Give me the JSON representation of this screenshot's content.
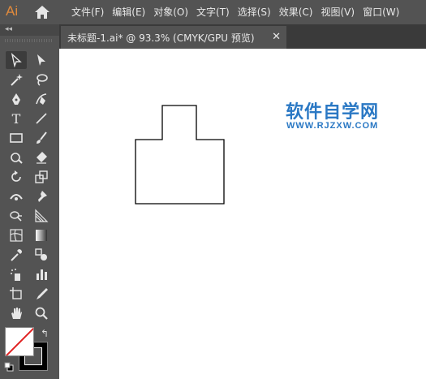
{
  "app": {
    "logo": "Ai"
  },
  "menu": [
    {
      "label": "文件(F)"
    },
    {
      "label": "编辑(E)"
    },
    {
      "label": "对象(O)"
    },
    {
      "label": "文字(T)"
    },
    {
      "label": "选择(S)"
    },
    {
      "label": "效果(C)"
    },
    {
      "label": "视图(V)"
    },
    {
      "label": "窗口(W)"
    }
  ],
  "toolbar": {
    "collapse": "◂◂",
    "tools": [
      "selection-tool",
      "direct-selection-tool",
      "magic-wand-tool",
      "lasso-tool",
      "pen-tool",
      "curvature-tool",
      "type-tool",
      "line-segment-tool",
      "rectangle-tool",
      "paintbrush-tool",
      "shaper-tool",
      "eraser-tool",
      "rotate-tool",
      "scale-tool",
      "width-tool",
      "puppet-warp-tool",
      "shape-builder-tool",
      "perspective-grid-tool",
      "mesh-tool",
      "gradient-tool",
      "eyedropper-tool",
      "blend-tool",
      "symbol-sprayer-tool",
      "column-graph-tool",
      "artboard-tool",
      "slice-tool",
      "hand-tool",
      "zoom-tool"
    ],
    "type_glyph": "T",
    "swap_glyph": "↰"
  },
  "document": {
    "tab_title": "未标题-1.ai* @ 93.3% (CMYK/GPU 预览)",
    "close_glyph": "✕"
  },
  "watermark": {
    "title": "软件自学网",
    "url": "WWW.RJZXW.COM",
    "color": "#2a78c4"
  }
}
